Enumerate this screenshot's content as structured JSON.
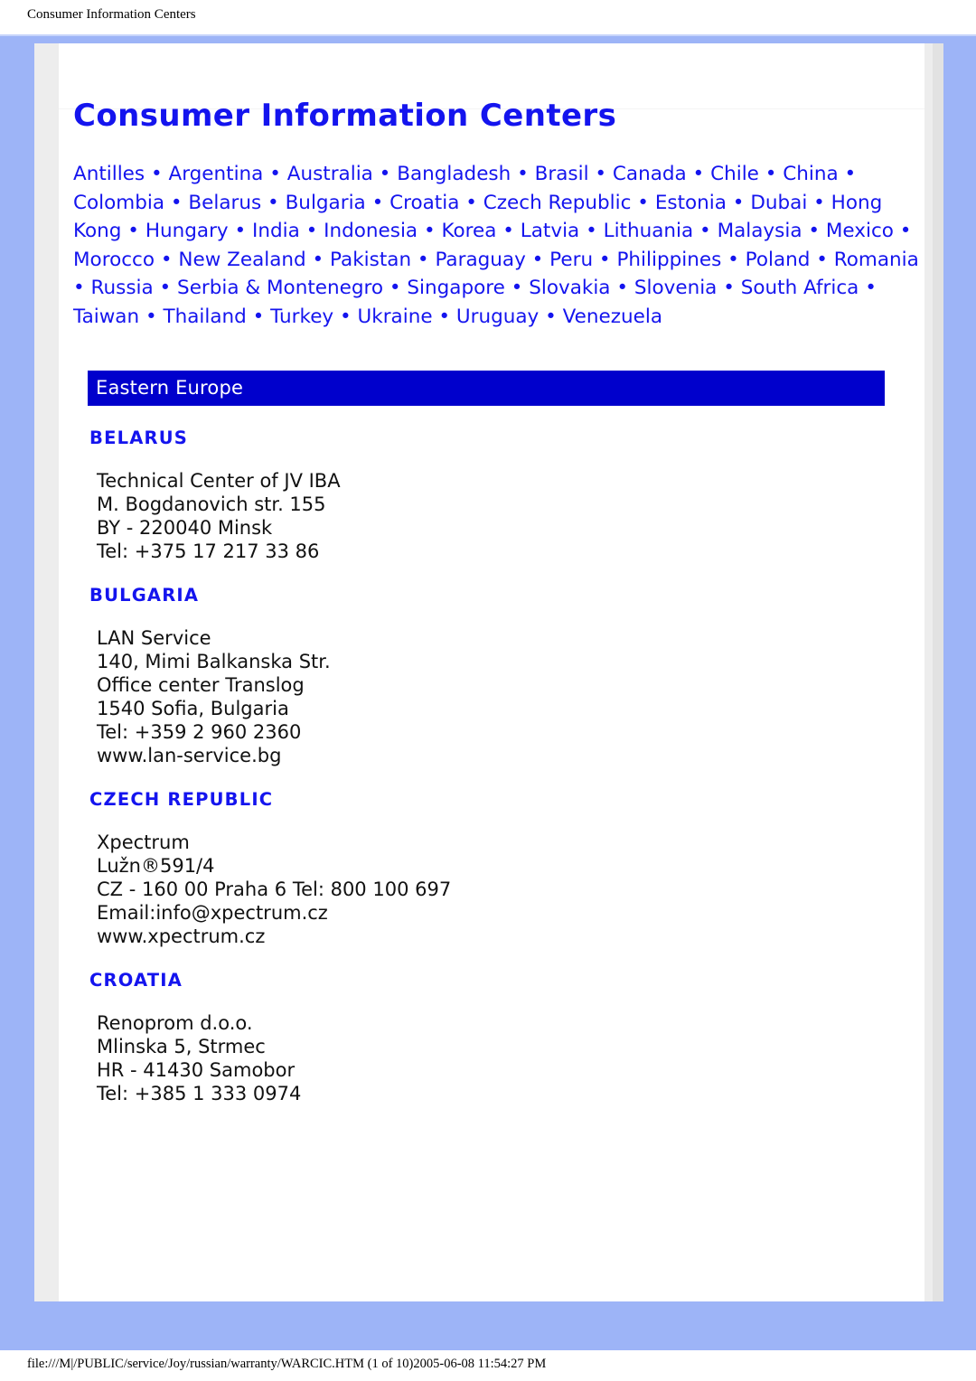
{
  "browser": {
    "page_header_title": "Consumer Information Centers",
    "page_footer": "file:///M|/PUBLIC/service/Joy/russian/warranty/WARCIC.HTM (1 of 10)2005-06-08 11:54:27 PM"
  },
  "colors": {
    "frame_blue": "#9db4f7",
    "banner_blue": "#0000cc",
    "link_blue": "#1414ee",
    "mat_gray": "#ededed",
    "sheet_white": "#ffffff",
    "body_text": "#111111"
  },
  "document": {
    "title": "Consumer Information Centers",
    "separator": "•",
    "country_index": [
      "Antilles",
      "Argentina",
      "Australia",
      "Bangladesh",
      "Brasil",
      "Canada",
      "Chile",
      "China",
      "Colombia",
      "Belarus",
      "Bulgaria",
      "Croatia",
      "Czech Republic",
      "Estonia",
      "Dubai",
      " Hong Kong",
      "Hungary",
      "India",
      "Indonesia",
      "Korea",
      "Latvia",
      "Lithuania",
      "Malaysia",
      "Mexico",
      "Morocco",
      "New Zealand",
      "Pakistan",
      "Paraguay",
      "Peru",
      "Philippines",
      "Poland",
      "Romania",
      "Russia",
      "Serbia & Montenegro",
      "Singapore",
      "Slovakia",
      "Slovenia",
      "South Africa",
      "Taiwan",
      "Thailand",
      "Turkey",
      "Ukraine",
      "Uruguay",
      "Venezuela"
    ],
    "regions": [
      {
        "name": "Eastern Europe",
        "countries": [
          {
            "name": "BELARUS",
            "address": "Technical Center of JV IBA\nM. Bogdanovich str. 155\nBY - 220040 Minsk\nTel: +375 17 217 33 86"
          },
          {
            "name": "BULGARIA",
            "address": "LAN Service\n140, Mimi Balkanska Str.\nOffice center Translog\n1540 Sofia, Bulgaria\nTel: +359 2 960 2360\nwww.lan-service.bg"
          },
          {
            "name": "CZECH REPUBLIC",
            "address": "Xpectrum\nLužn®591/4\nCZ - 160 00 Praha 6 Tel: 800 100 697\nEmail:info@xpectrum.cz\nwww.xpectrum.cz"
          },
          {
            "name": "CROATIA",
            "address": "Renoprom d.o.o.\nMlinska 5, Strmec\nHR - 41430 Samobor\nTel: +385 1 333 0974"
          }
        ]
      }
    ]
  }
}
